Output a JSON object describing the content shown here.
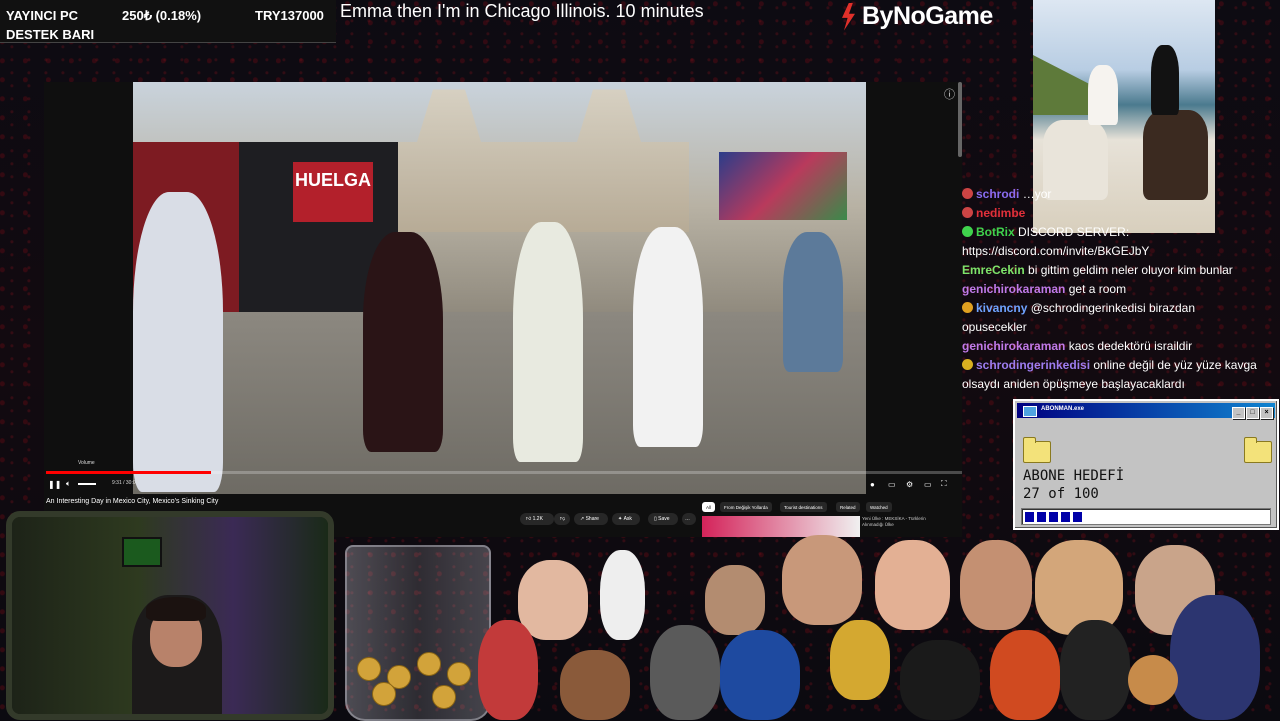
{
  "info_bar": {
    "label_pc": "YAYINCI PC",
    "label_destek": "DESTEK BARI",
    "amount": "250₺ (0.18%)",
    "target": "TRY137000"
  },
  "top_caption": "Emma then I'm in Chicago Illinois. 10 minutes",
  "brand": "ByNoGame",
  "player": {
    "volume_tooltip": "Volume",
    "time": "9:31 / 30:07",
    "progress_fraction": 0.18,
    "video_title": "An Interesting Day in Mexico City, Mexico's Sinking City",
    "banner_text": "HUELGA",
    "actions": {
      "like": "1.2K",
      "share": "Share",
      "ask": "Ask",
      "save": "Save",
      "more": "…"
    },
    "chips": [
      "All",
      "From Değişik Yollarda",
      "Tourist destinations",
      "Related",
      "Watched"
    ],
    "recommended_title": "Yeni Ülke : MEKSİKA - Türklerin Alınmadığı Ülke"
  },
  "chat": [
    {
      "user": "schrodi",
      "color": "#8a6cf0",
      "text": "…yor",
      "badge": "#c44"
    },
    {
      "user": "nedimbe",
      "color": "#e0303a",
      "text": "",
      "badge": "#c44"
    },
    {
      "user": "BotRix",
      "color": "#3fd24d",
      "text": "DISCORD SERVER:",
      "badge": "#3fd24d"
    },
    {
      "user": "",
      "color": "#fff",
      "text": "https://discord.com/invite/BkGEJbY",
      "badge": ""
    },
    {
      "user": "EmreCekin",
      "color": "#7ee36a",
      "text": "bi gittim geldim neler oluyor kim bunlar",
      "badge": ""
    },
    {
      "user": "genichirokaraman",
      "color": "#c07ae8",
      "text": "get a room",
      "badge": ""
    },
    {
      "user": "kivancny",
      "color": "#6fa3ff",
      "text": "@schrodingerinkedisi birazdan",
      "badge": "#e0a020"
    },
    {
      "user": "",
      "color": "#fff",
      "text": "opusecekler",
      "badge": ""
    },
    {
      "user": "genichirokaraman",
      "color": "#c07ae8",
      "text": "kaos dedektörü israildir",
      "badge": ""
    },
    {
      "user": "schrodingerinkedisi",
      "color": "#9d7df0",
      "text": "online değil de yüz yüze kavga",
      "badge": "#d8b020"
    },
    {
      "user": "",
      "color": "#fff",
      "text": "olsaydı aniden öpüşmeye başlayacaklardı",
      "badge": ""
    }
  ],
  "goal": {
    "window_title": "ABONMAN.exe",
    "label": "ABONE HEDEFİ",
    "count": "27 of 100",
    "progress_fraction": 0.27,
    "accent": "#0000a8"
  },
  "colors": {
    "background": "#0b0a10",
    "progress": "#ff0000",
    "titlebar": "#000080"
  }
}
